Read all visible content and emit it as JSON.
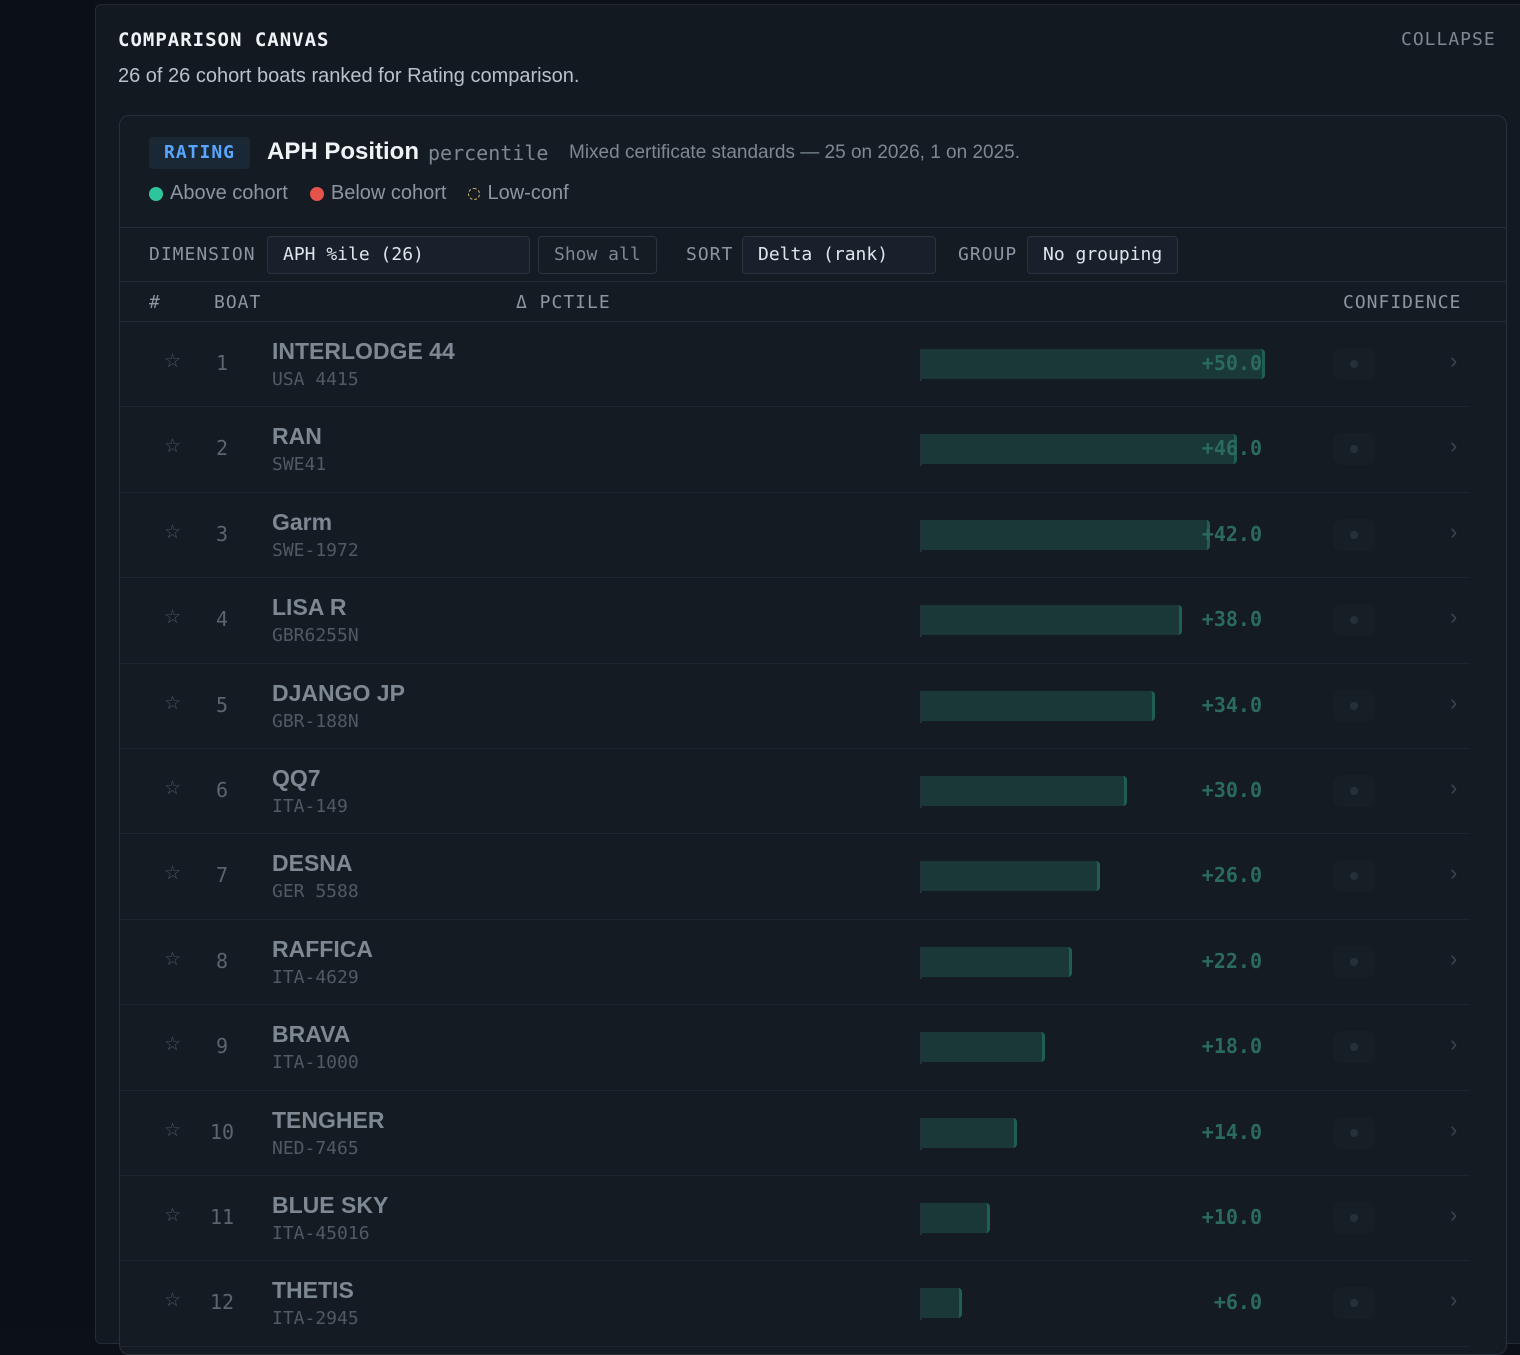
{
  "panel": {
    "title": "COMPARISON CANVAS",
    "collapse_label": "COLLAPSE",
    "subtitle": "26 of 26 cohort boats ranked for Rating comparison."
  },
  "card": {
    "badge": "RATING",
    "metric_title": "APH Position",
    "metric_unit": "percentile",
    "metric_note": "Mixed certificate standards — 25 on 2026, 1 on 2025.",
    "legend": {
      "above": "Above cohort",
      "below": "Below cohort",
      "low": "Low-conf"
    },
    "colors": {
      "above": "#2fc59a",
      "below": "#e5534b",
      "accent": "#58a6ff"
    }
  },
  "controls": {
    "dimension_label": "DIMENSION",
    "dimension_value": "APH %ile (26)",
    "show_all_label": "Show all",
    "sort_label": "SORT",
    "sort_value": "Delta (rank)",
    "group_label": "GROUP",
    "group_value": "No grouping"
  },
  "table": {
    "headers": {
      "rank": "#",
      "boat": "BOAT",
      "delta": "Δ PCTILE",
      "confidence": "CONFIDENCE"
    },
    "max_delta": 50,
    "rows": [
      {
        "rank": "1",
        "name": "INTERLODGE 44",
        "sail": "USA 4415",
        "delta": 50,
        "delta_label": "+50.0"
      },
      {
        "rank": "2",
        "name": "RAN",
        "sail": "SWE41",
        "delta": 46,
        "delta_label": "+46.0"
      },
      {
        "rank": "3",
        "name": "Garm",
        "sail": "SWE-1972",
        "delta": 42,
        "delta_label": "+42.0"
      },
      {
        "rank": "4",
        "name": "LISA R",
        "sail": "GBR6255N",
        "delta": 38,
        "delta_label": "+38.0"
      },
      {
        "rank": "5",
        "name": "DJANGO JP",
        "sail": "GBR-188N",
        "delta": 34,
        "delta_label": "+34.0"
      },
      {
        "rank": "6",
        "name": "QQ7",
        "sail": "ITA-149",
        "delta": 30,
        "delta_label": "+30.0"
      },
      {
        "rank": "7",
        "name": "DESNA",
        "sail": "GER 5588",
        "delta": 26,
        "delta_label": "+26.0"
      },
      {
        "rank": "8",
        "name": "RAFFICA",
        "sail": "ITA-4629",
        "delta": 22,
        "delta_label": "+22.0"
      },
      {
        "rank": "9",
        "name": "BRAVA",
        "sail": "ITA-1000",
        "delta": 18,
        "delta_label": "+18.0"
      },
      {
        "rank": "10",
        "name": "TENGHER",
        "sail": "NED-7465",
        "delta": 14,
        "delta_label": "+14.0"
      },
      {
        "rank": "11",
        "name": "BLUE SKY",
        "sail": "ITA-45016",
        "delta": 10,
        "delta_label": "+10.0"
      },
      {
        "rank": "12",
        "name": "THETIS",
        "sail": "ITA-2945",
        "delta": 6,
        "delta_label": "+6.0"
      }
    ]
  }
}
